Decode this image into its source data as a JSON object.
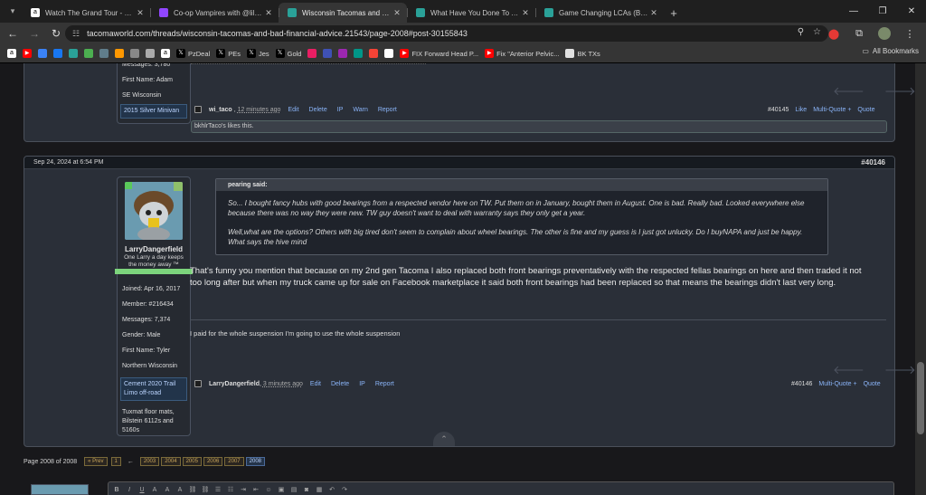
{
  "tabs": [
    {
      "title": "Watch The Grand Tour - Season",
      "icon": "amazon-icon",
      "color": "#ffffff",
      "active": false
    },
    {
      "title": "Co-op Vampires with @lil_lexi",
      "icon": "twitch-icon",
      "color": "#9146ff",
      "active": false
    },
    {
      "title": "Wisconsin Tacomas and bad fin",
      "icon": "tacomaworld-icon",
      "color": "#2aa198",
      "active": true
    },
    {
      "title": "What Have You Done To Your 3",
      "icon": "tacomaworld-icon",
      "color": "#2aa198",
      "active": false
    },
    {
      "title": "Game Changing LCAs (BTFFabri",
      "icon": "tacomaworld-icon",
      "color": "#2aa198",
      "active": false
    }
  ],
  "address": {
    "url": "tacomaworld.com/threads/wisconsin-tacomas-and-bad-financial-advice.21543/page-2008#post-30155843"
  },
  "bookmarks": [
    {
      "label": "",
      "icon": "a-icon",
      "color": "#ffffff"
    },
    {
      "label": "",
      "icon": "youtube-icon",
      "color": "#ff0000"
    },
    {
      "label": "",
      "icon": "sling-icon",
      "color": "#3b82f6"
    },
    {
      "label": "",
      "icon": "facebook-icon",
      "color": "#1877f2"
    },
    {
      "label": "",
      "icon": "site-icon",
      "color": "#2aa198"
    },
    {
      "label": "",
      "icon": "site-icon",
      "color": "#4caf50"
    },
    {
      "label": "",
      "icon": "site-icon",
      "color": "#607d8b"
    },
    {
      "label": "",
      "icon": "site-icon",
      "color": "#ff9800"
    },
    {
      "label": "",
      "icon": "site-icon",
      "color": "#888888"
    },
    {
      "label": "",
      "icon": "site-icon",
      "color": "#aaaaaa"
    },
    {
      "label": "",
      "icon": "amazon-icon",
      "color": "#ffffff"
    },
    {
      "label": "PzDeal",
      "icon": "x-icon",
      "color": "#000000"
    },
    {
      "label": "PEs",
      "icon": "x-icon",
      "color": "#000000"
    },
    {
      "label": "Jes",
      "icon": "x-icon",
      "color": "#000000"
    },
    {
      "label": "Gold",
      "icon": "x-icon",
      "color": "#000000"
    },
    {
      "label": "",
      "icon": "site-icon",
      "color": "#e91e63"
    },
    {
      "label": "",
      "icon": "site-icon",
      "color": "#3f51b5"
    },
    {
      "label": "",
      "icon": "site-icon",
      "color": "#9c27b0"
    },
    {
      "label": "",
      "icon": "site-icon",
      "color": "#009688"
    },
    {
      "label": "",
      "icon": "site-icon",
      "color": "#f44336"
    },
    {
      "label": "",
      "icon": "site-icon",
      "color": "#ffffff"
    },
    {
      "label": "FIX Forward Head P...",
      "icon": "youtube-icon",
      "color": "#ff0000"
    },
    {
      "label": "Fix \"Anterior Pelvic...",
      "icon": "youtube-icon",
      "color": "#ff0000"
    },
    {
      "label": "BK TXs",
      "icon": "site-icon",
      "color": "#e0e0e0"
    }
  ],
  "all_bookmarks": "All Bookmarks",
  "prev_post": {
    "user": {
      "messages": "Messages: 3,780",
      "first_name": "First Name: Adam",
      "location": "SE Wisconsin",
      "vehicle": "2015 Silver Minivan"
    },
    "author": "wi_taco",
    "time": "12 minutes ago",
    "actions": [
      "Edit",
      "Delete",
      "IP",
      "Warn",
      "Report"
    ],
    "number": "#40145",
    "right_actions": [
      "Like",
      "Multi-Quote +",
      "Quote"
    ],
    "likes": "bkhlrTaco's likes this."
  },
  "post": {
    "date": "Sep 24, 2024 at 6:54 PM",
    "number": "#40146",
    "user": {
      "name": "LarryDangerfield",
      "title": "One Larry a day keeps the money away ™",
      "joined": "Joined: Apr 16, 2017",
      "member": "Member: #216434",
      "messages": "Messages: 7,374",
      "gender": "Gender: Male",
      "first_name": "First Name: Tyler",
      "location": "Northern Wisconsin",
      "vehicle": "Cement 2020 Trail Limo off-road",
      "mods": "Tuxmat floor mats, Bilstein 6112s and 5160s"
    },
    "quote": {
      "author": "pearing said:",
      "p1": "So... I bought fancy hubs with good bearings from a respected vendor here on TW. Put them on in January, bought them in August. One is bad. Really bad. Looked everywhere else because there was no way they were new. TW guy doesn't want to deal with warranty says they only get a year.",
      "p2": "Well,what are the options? Others with big tired don't seem to complain about wheel bearings. The other is fine and my guess is I just got unlucky. Do I buyNAPA and just be happy. What says the hive mind"
    },
    "body": "That's funny you mention that because on my 2nd gen Tacoma I also replaced both front bearings preventatively with the respected fellas bearings on here and then traded it not too long after but when my truck came up for sale on Facebook marketplace it said both front bearings had been replaced so that means the bearings didn't last very long.",
    "signature": "I paid for the whole suspension I'm going to use the whole suspension",
    "author": "LarryDangerfield",
    "time": "3 minutes ago",
    "actions": [
      "Edit",
      "Delete",
      "IP",
      "Report"
    ],
    "right_number": "#40146",
    "right_actions": [
      "Multi-Quote +",
      "Quote"
    ]
  },
  "pagination": {
    "label": "Page 2008 of 2008",
    "prev": "« Prev",
    "first": "1",
    "ellipsis": "←",
    "pages": [
      "2003",
      "2004",
      "2005",
      "2006",
      "2007",
      "2008"
    ]
  }
}
